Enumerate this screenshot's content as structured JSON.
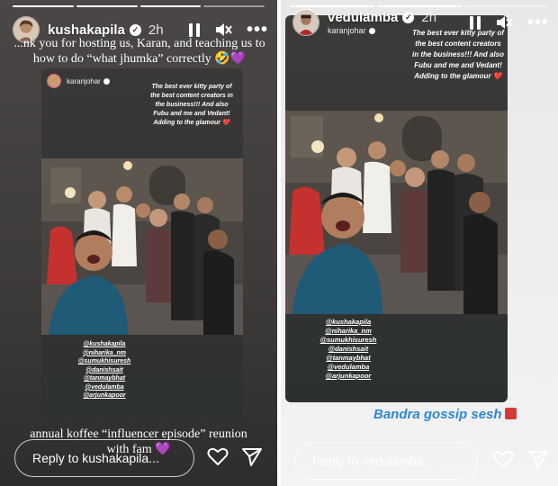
{
  "left_story": {
    "username": "kushakapila",
    "time": "2h",
    "caption_top": "...nk you for hosting us, Karan, and teaching us to how to do “what jhumka” correctly 🤣💜",
    "caption_bottom": "annual koffee “influencer episode” reunion with fam 💜",
    "reply_placeholder": "Reply to kushakapila...",
    "icons": [
      "pause-icon",
      "mute-icon",
      "more-icon",
      "heart-icon",
      "send-icon"
    ]
  },
  "right_story": {
    "username": "vedulamba",
    "time": "2h",
    "sub_username": "karanjohar",
    "reply_placeholder": "Reply to vedulamba...",
    "sticker_text": "Bandra gossip sesh",
    "icons": [
      "pause-icon",
      "mute-icon",
      "more-icon",
      "heart-icon",
      "send-icon"
    ]
  },
  "shared_story": {
    "author": "karanjohar",
    "caption": "The best ever kitty party of the best content creators in the business!!! And also Fubu and me and Vedant! Adding to the glamour ❤️",
    "tags": [
      "@kushakapila",
      "@niharika_nm",
      "@sumukhisuresh",
      "@danishsait",
      "@tanmaybhat",
      "@vedulamba",
      "@arjunkapoor"
    ]
  },
  "colors": {
    "left_bg": "#3d3a3a",
    "right_bg": "#efefef",
    "card_bg": "#2d3232",
    "sticker_blue": "#2e86d8",
    "heart_red": "#e0243a"
  }
}
